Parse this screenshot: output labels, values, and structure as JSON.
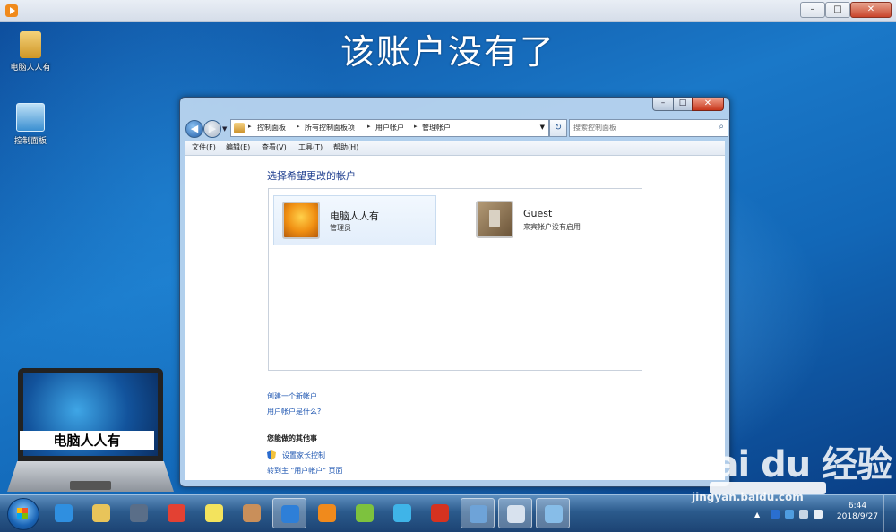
{
  "banner": {
    "title": "该账户没有了"
  },
  "desktop": {
    "icons": [
      {
        "label": "电脑人人有"
      },
      {
        "label": "控制面板"
      }
    ]
  },
  "laptop": {
    "caption": "电脑人人有"
  },
  "window": {
    "breadcrumbs": [
      "控制面板",
      "所有控制面板项",
      "用户帐户",
      "管理帐户"
    ],
    "search_placeholder": "搜索控制面板",
    "menu": [
      "文件(F)",
      "编辑(E)",
      "查看(V)",
      "工具(T)",
      "帮助(H)"
    ],
    "heading": "选择希望更改的帐户",
    "accounts": [
      {
        "name": "电脑人人有",
        "subtitle": "管理员"
      },
      {
        "name": "Guest",
        "subtitle": "来宾帐户没有启用"
      }
    ],
    "links": {
      "create": "创建一个新帐户",
      "what": "用户帐户是什么?",
      "other_heading": "您能做的其他事",
      "parental": "设置家长控制",
      "goto": "转到主 \"用户帐户\" 页面"
    },
    "controls": {
      "minimize": "–",
      "maximize": "□",
      "close": "✕"
    }
  },
  "outer_controls": {
    "minimize": "–",
    "maximize": "□",
    "close": "✕"
  },
  "taskbar": {
    "apps": [
      {
        "icon": "ie-icon",
        "color": "#2f8fe0"
      },
      {
        "icon": "folder-icon",
        "color": "#e8c45a"
      },
      {
        "icon": "media-icon",
        "color": "#5a6e88"
      },
      {
        "icon": "chrome-icon",
        "color": "#e34133"
      },
      {
        "icon": "sticky-icon",
        "color": "#f3e35d"
      },
      {
        "icon": "paint-icon",
        "color": "#c98f5a"
      },
      {
        "icon": "sogou-icon",
        "color": "#2e7fd8"
      },
      {
        "icon": "player-icon",
        "color": "#f08a1c"
      },
      {
        "icon": "pinwheel-icon",
        "color": "#7dc23e"
      },
      {
        "icon": "cloud-icon",
        "color": "#3fb4e8"
      },
      {
        "icon": "chess-icon",
        "color": "#d6321f"
      },
      {
        "icon": "network-icon",
        "color": "#6ea3d8"
      },
      {
        "icon": "monitor-icon",
        "color": "#d8e2ee"
      },
      {
        "icon": "control-panel-icon",
        "color": "#87bde8"
      }
    ],
    "clock_time": "6:44",
    "clock_date": "2018/9/27"
  },
  "watermark": {
    "logo": "Bai du 经验",
    "sub": "jingyan.baidu.com"
  }
}
